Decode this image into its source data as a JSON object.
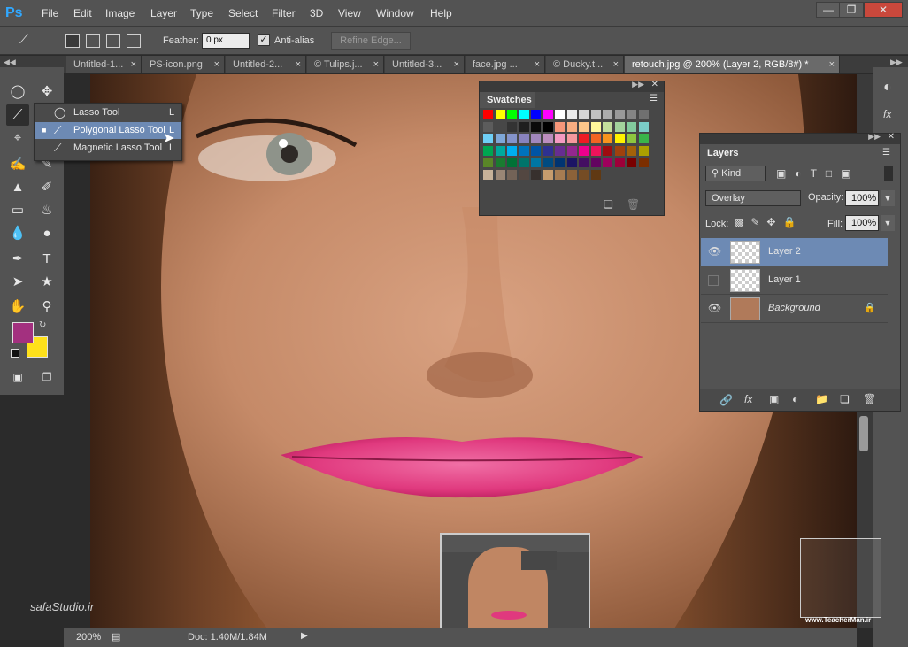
{
  "app": {
    "logo": "Ps"
  },
  "menu": [
    "File",
    "Edit",
    "Image",
    "Layer",
    "Type",
    "Select",
    "Filter",
    "3D",
    "View",
    "Window",
    "Help"
  ],
  "options": {
    "feather_label": "Feather:",
    "feather_value": "0 px",
    "antialias_label": "Anti-alias",
    "antialias_checked": true,
    "refine_label": "Refine Edge..."
  },
  "tabs": [
    {
      "label": "Untitled-1...",
      "close": "×"
    },
    {
      "label": "PS-icon.png",
      "close": "×"
    },
    {
      "label": "Untitled-2...",
      "close": "×"
    },
    {
      "label": "© Tulips.j...",
      "close": "×"
    },
    {
      "label": "Untitled-3...",
      "close": "×"
    },
    {
      "label": "face.jpg ...",
      "close": "×"
    },
    {
      "label": "© Ducky.t...",
      "close": "×"
    },
    {
      "label": "retouch.jpg @ 200% (Layer 2, RGB/8#) *",
      "close": "×"
    }
  ],
  "flyout": {
    "items": [
      {
        "label": "Lasso Tool",
        "key": "L",
        "selected": false
      },
      {
        "label": "Polygonal Lasso Tool",
        "key": "L",
        "selected": true
      },
      {
        "label": "Magnetic Lasso Tool",
        "key": "L",
        "selected": false
      }
    ]
  },
  "swatches": {
    "title": "Swatches",
    "rows": [
      [
        "#ff0000",
        "#ffff00",
        "#00ff00",
        "#00ffff",
        "#0000ff",
        "#ff00ff",
        "#ffffff",
        "#ebebeb",
        "#d6d6d6",
        "#c2c2c2",
        "#adadad",
        "#999999",
        "#858585",
        "#707070"
      ],
      [
        "#5c5c5c",
        "#474747",
        "#333333",
        "#1f1f1f",
        "#0a0a0a",
        "#000000",
        "#f7977a",
        "#f9ad81",
        "#fdc68a",
        "#fff79a",
        "#c4df9b",
        "#a3d39c",
        "#82ca9d",
        "#7bcdc8"
      ],
      [
        "#6ecff6",
        "#7ea7d8",
        "#8493ca",
        "#8882be",
        "#a187be",
        "#bc8dbf",
        "#f49ac2",
        "#f6989d",
        "#ed1c24",
        "#f26522",
        "#f7941d",
        "#fff200",
        "#8dc73f",
        "#39b54a"
      ],
      [
        "#00a651",
        "#00a99d",
        "#00aeef",
        "#0072bc",
        "#0054a6",
        "#2e3192",
        "#662d91",
        "#92278f",
        "#ec008c",
        "#ed145b",
        "#9e0b0f",
        "#a0410d",
        "#a36209",
        "#aba000"
      ],
      [
        "#598527",
        "#1a7b30",
        "#007236",
        "#00746b",
        "#0076a3",
        "#004b80",
        "#003471",
        "#1b1464",
        "#440e62",
        "#630460",
        "#9e005d",
        "#9e0039",
        "#790000",
        "#7b2e00"
      ],
      [
        "#c7b299",
        "#998675",
        "#736357",
        "#534741",
        "#37302d",
        "#c69c6d",
        "#a67c52",
        "#8c6239",
        "#754c24",
        "#603913"
      ]
    ]
  },
  "layers": {
    "title": "Layers",
    "kind_label": "Kind",
    "blend_mode": "Overlay",
    "opacity_label": "Opacity:",
    "opacity_value": "100%",
    "lock_label": "Lock:",
    "fill_label": "Fill:",
    "fill_value": "100%",
    "items": [
      {
        "name": "Layer 2",
        "visible": true,
        "selected": true
      },
      {
        "name": "Layer 1",
        "visible": false,
        "selected": false
      },
      {
        "name": "Background",
        "visible": true,
        "selected": false,
        "locked": true
      }
    ]
  },
  "status": {
    "zoom": "200%",
    "doc": "Doc: 1.40M/1.84M"
  },
  "watermark": {
    "left_site": "safaStudio.ir",
    "right_site": "www.TeacherMan.ir"
  },
  "colors": {
    "foreground": "#a3307f",
    "background": "#ffe11a",
    "selection": "#6d8ab4"
  }
}
